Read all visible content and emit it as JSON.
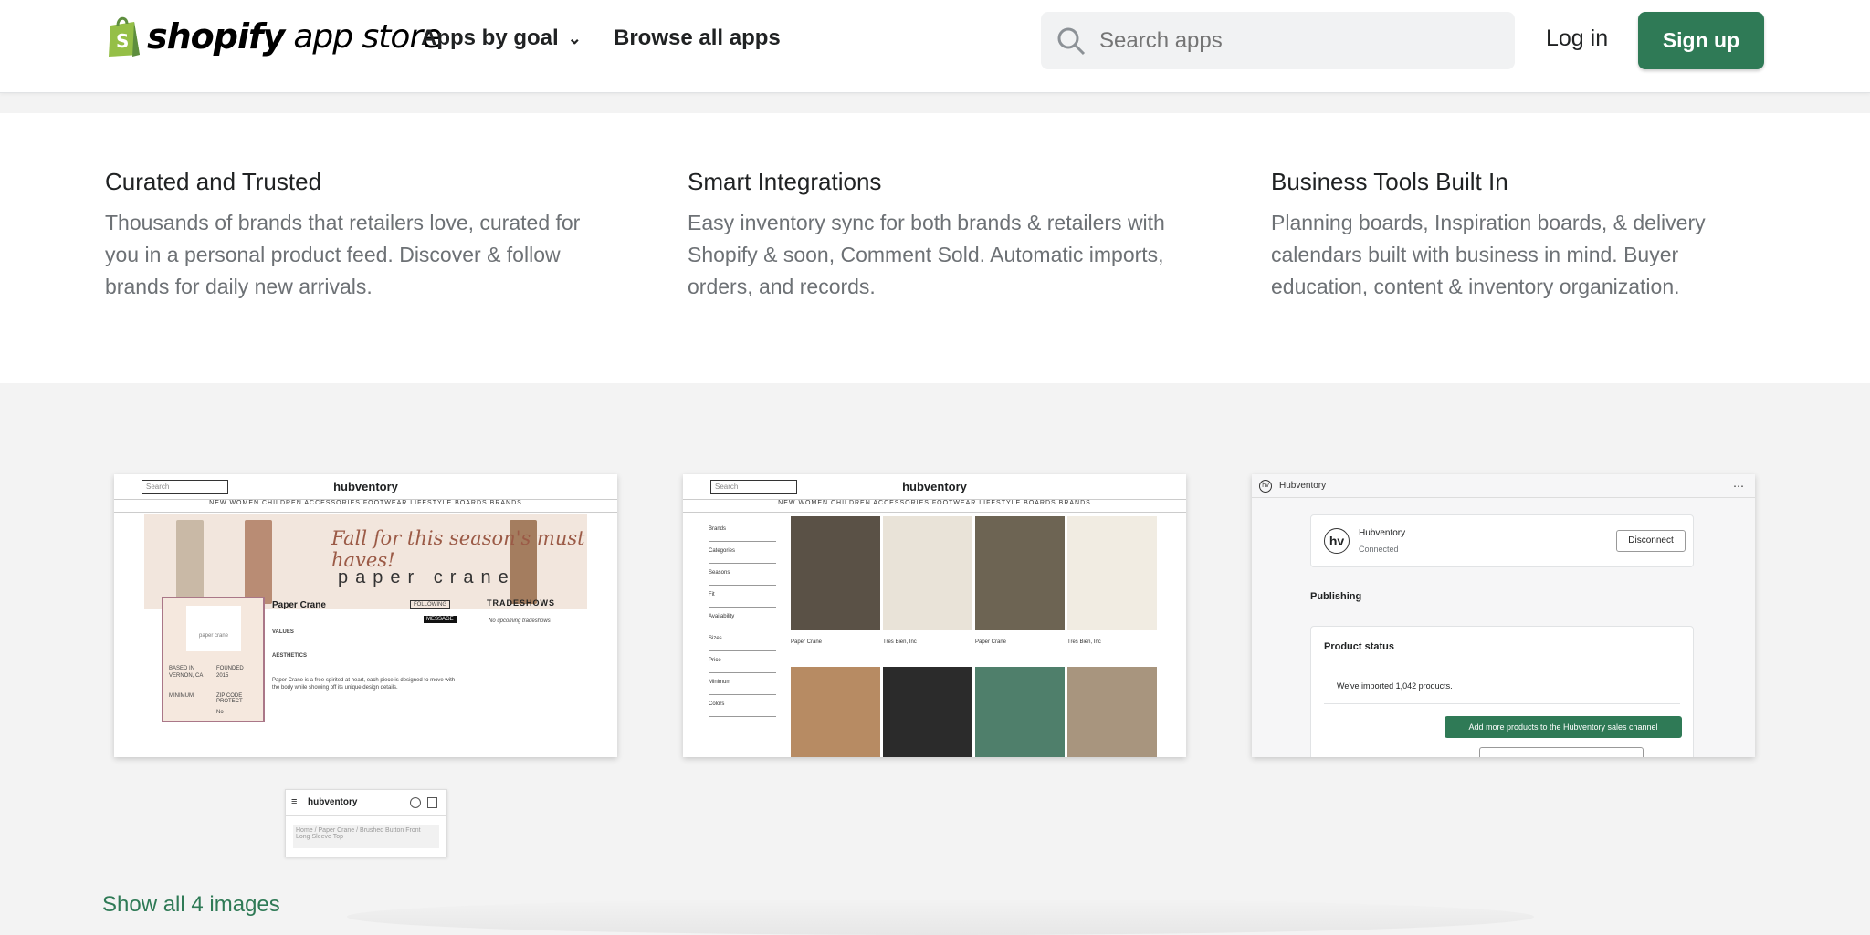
{
  "header": {
    "brand": "shopify",
    "brand_suffix": "app store",
    "nav_goal": "Apps by goal",
    "nav_browse": "Browse all apps",
    "search_placeholder": "Search apps",
    "login": "Log in",
    "signup": "Sign up"
  },
  "features": [
    {
      "title": "Curated and Trusted",
      "text": "Thousands of brands that retailers love, curated for you in a personal product feed. Discover & follow brands for daily new arrivals."
    },
    {
      "title": "Smart Integrations",
      "text": "Easy inventory sync for both brands & retailers with Shopify & soon, Comment Sold. Automatic imports, orders, and records."
    },
    {
      "title": "Business Tools Built In",
      "text": "Planning boards, Inspiration boards, & delivery calendars built with business in mind. Buyer education, content & inventory organization."
    }
  ],
  "screenshots": {
    "s1": {
      "logo": "hubventory",
      "search": "Search",
      "menu": "NEW  WOMEN  CHILDREN  ACCESSORIES  FOOTWEAR  LIFESTYLE  BOARDS  BRANDS",
      "headline": "Fall for this season's must haves!",
      "brand_mark": "paper crane",
      "brand_name": "Paper Crane",
      "following": "FOLLOWING",
      "message": "MESSAGE",
      "tradeshows": "TRADESHOWS",
      "no_tradeshows": "No upcoming tradeshows",
      "values": "VALUES",
      "based_in": "BASED IN",
      "location": "VERNON, CA",
      "founded": "FOUNDED",
      "year": "2015",
      "minimum": "MINIMUM",
      "zip": "ZIP CODE PROTECT",
      "zip_val": "No",
      "aesthetics": "AESTHETICS",
      "description": "Paper Crane is a free-spirited at heart, each piece is designed to move with the body while showing off its unique design details."
    },
    "s2": {
      "logo": "hubventory",
      "search": "Search",
      "menu": "NEW  WOMEN  CHILDREN  ACCESSORIES  FOOTWEAR  LIFESTYLE  BOARDS  BRANDS",
      "filters": [
        "Brands",
        "Categories",
        "Seasons",
        "Fit",
        "Availability",
        "Sizes",
        "Price",
        "Minimum",
        "Colors"
      ],
      "products": [
        {
          "brand": "Paper Crane",
          "color": "#5a5146"
        },
        {
          "brand": "Tres Bien, Inc",
          "color": "#e9e3d8"
        },
        {
          "brand": "Paper Crane",
          "color": "#6d6453"
        },
        {
          "brand": "Tres Bien, Inc",
          "color": "#f1ece2"
        },
        {
          "brand": "",
          "color": "#b78b63"
        },
        {
          "brand": "",
          "color": "#2b2b2b"
        },
        {
          "brand": "",
          "color": "#4f7f6b"
        },
        {
          "brand": "",
          "color": "#a8957e"
        }
      ]
    },
    "s3": {
      "app_name": "Hubventory",
      "connected": "Connected",
      "disconnect": "Disconnect",
      "publishing": "Publishing",
      "status_title": "Product status",
      "imported": "We've imported 1,042 products.",
      "add_more": "Add more products to the Hubventory sales channel"
    },
    "mobile": {
      "logo": "hubventory",
      "crumb": "Home / Paper Crane / Brushed Button Front Long Sleeve Top"
    }
  },
  "show_all": "Show all 4 images",
  "colors": {
    "accent": "#2f7a56"
  }
}
